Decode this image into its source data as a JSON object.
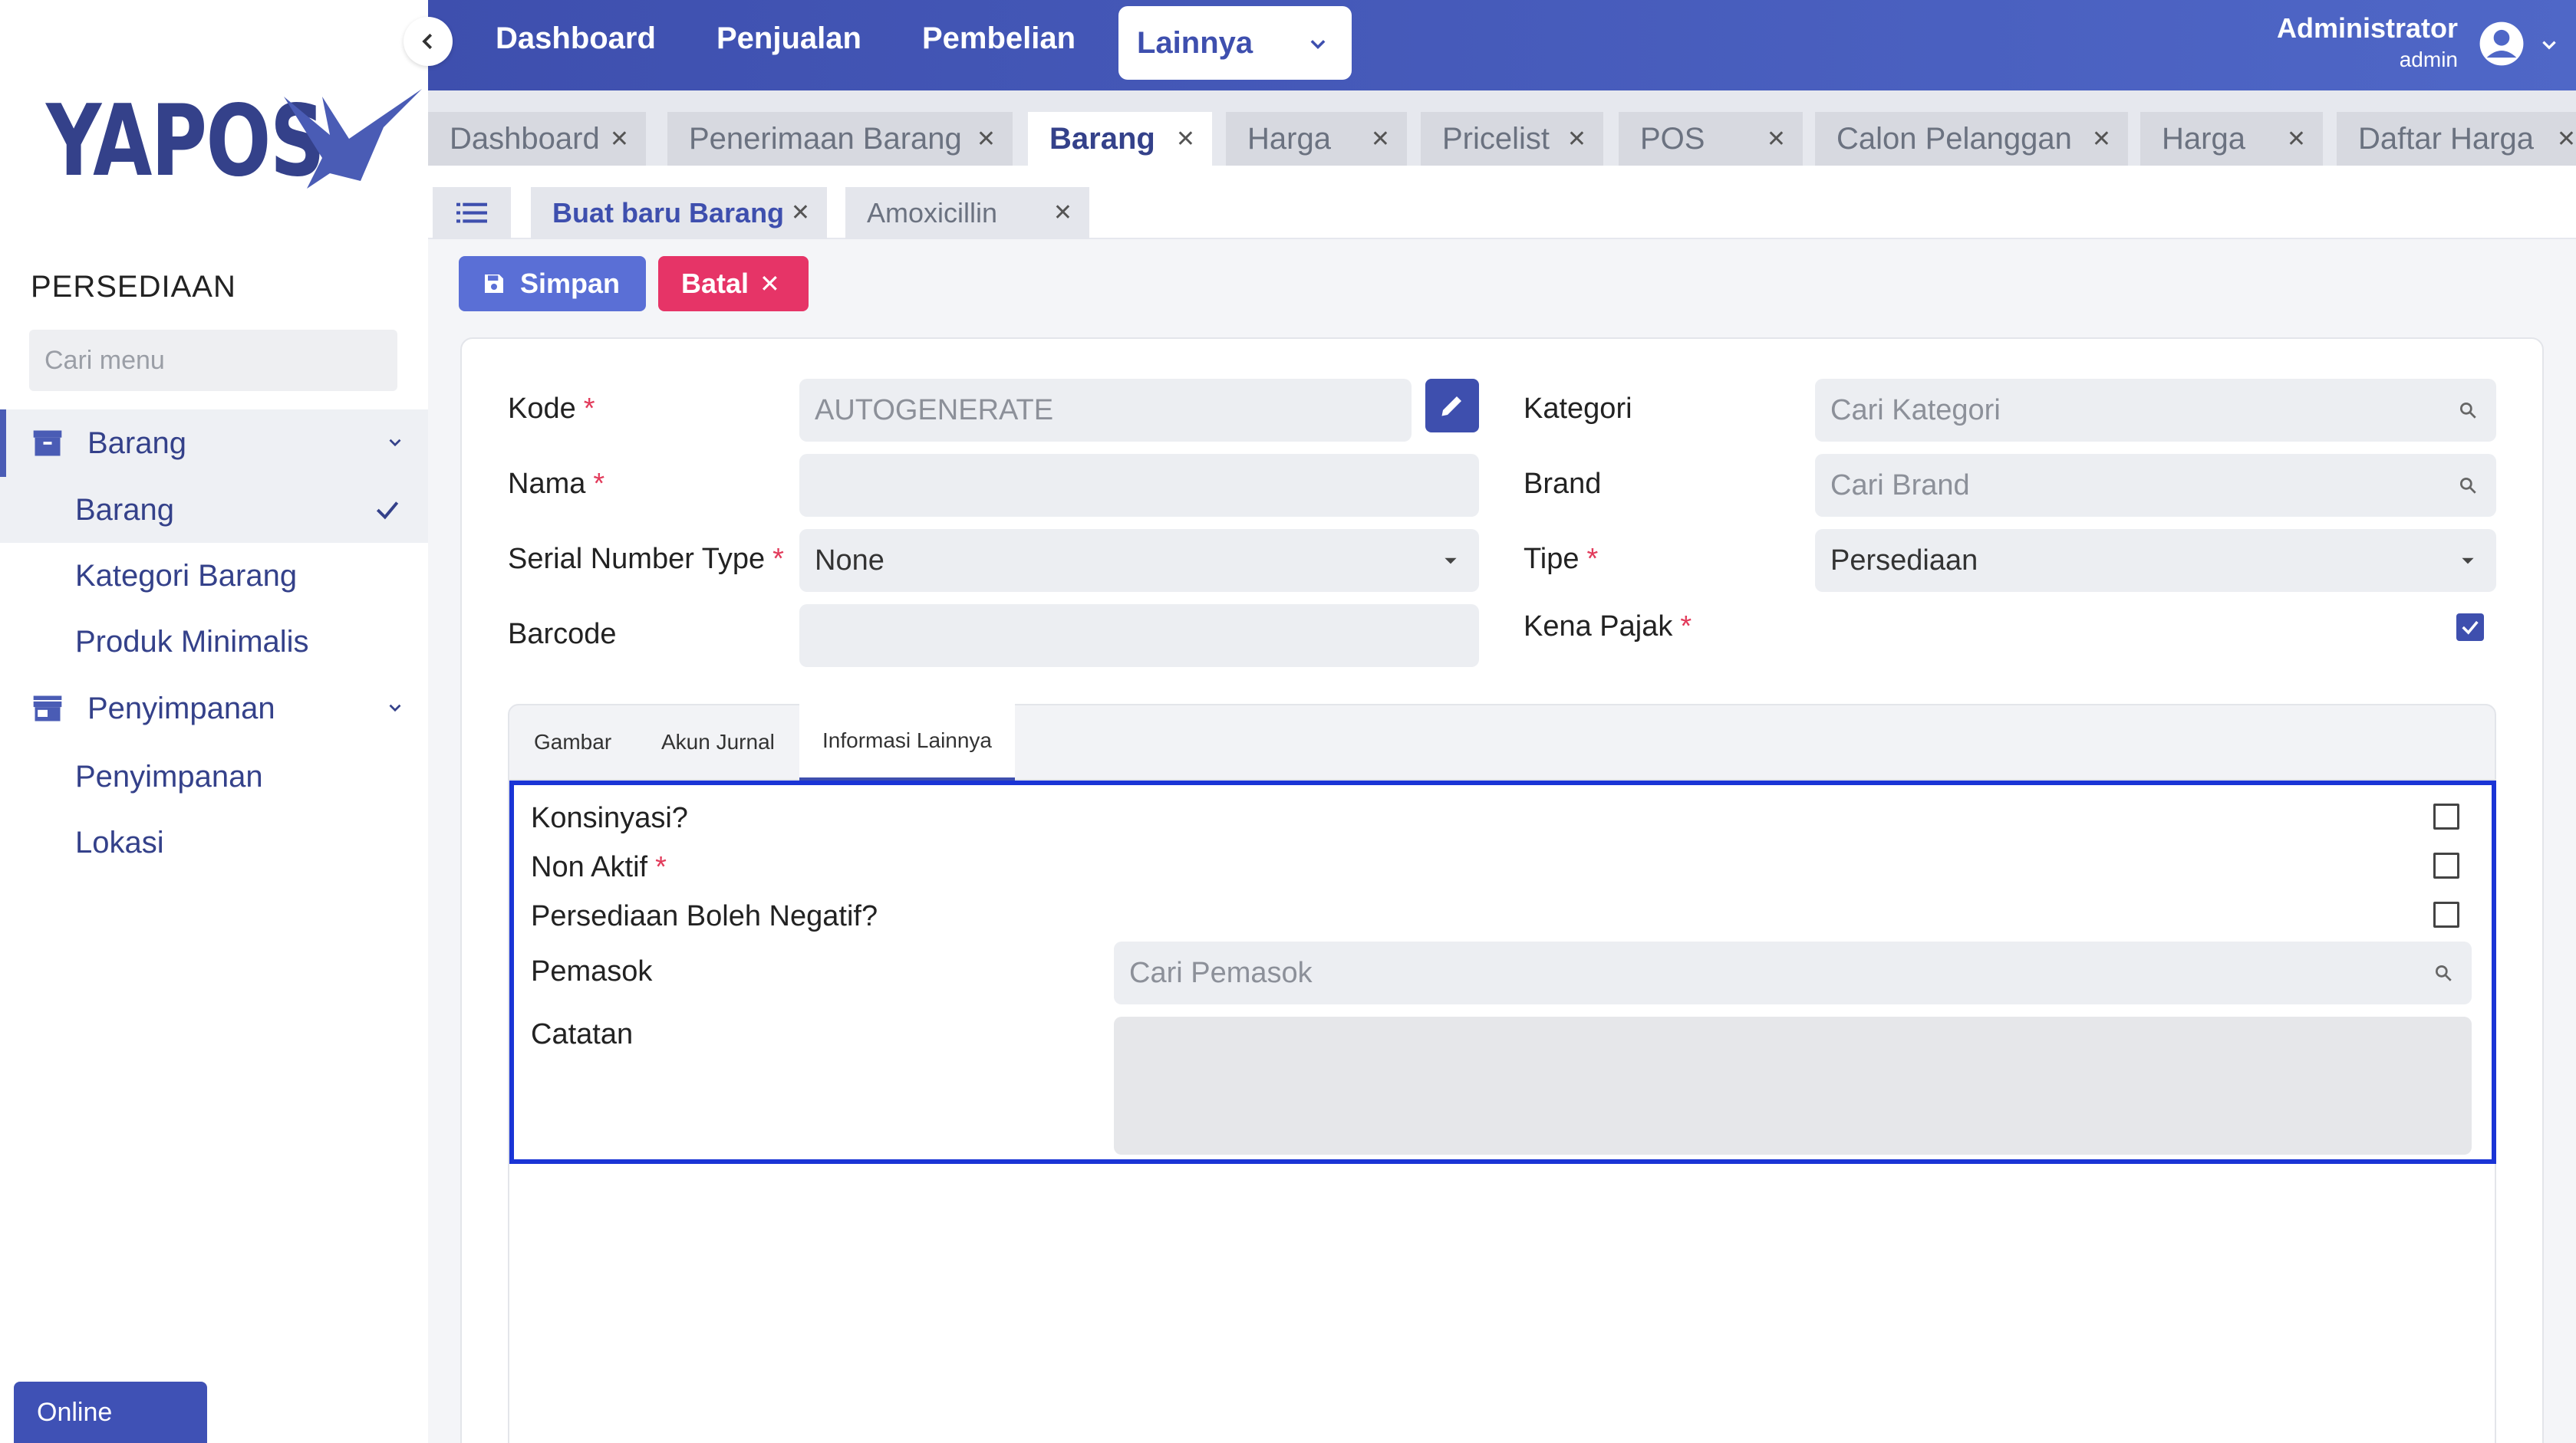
{
  "app": {
    "logo": "YAPOS",
    "brand_color": "#3e4fae"
  },
  "sidebar": {
    "section_title": "PERSEDIAAN",
    "search_placeholder": "Cari menu",
    "groups": [
      {
        "label": "Barang",
        "icon": "archive-icon",
        "items": [
          {
            "label": "Barang",
            "active": true
          },
          {
            "label": "Kategori Barang"
          },
          {
            "label": "Produk Minimalis"
          }
        ]
      },
      {
        "label": "Penyimpanan",
        "icon": "store-icon",
        "items": [
          {
            "label": "Penyimpanan"
          },
          {
            "label": "Lokasi"
          }
        ]
      }
    ],
    "status": "Online"
  },
  "topnav": {
    "items": [
      "Dashboard",
      "Penjualan",
      "Pembelian",
      "Lainnya"
    ],
    "user_name": "Administrator",
    "user_role": "admin"
  },
  "main_tabs": [
    "Dashboard",
    "Penerimaan Barang",
    "Barang",
    "Harga",
    "Pricelist",
    "POS",
    "Calon Pelanggan",
    "Harga",
    "Daftar Harga"
  ],
  "sub_tabs": [
    "Buat baru Barang",
    "Amoxicillin"
  ],
  "actions": {
    "save": "Simpan",
    "cancel": "Batal"
  },
  "form": {
    "kode": {
      "label": "Kode",
      "value": "AUTOGENERATE"
    },
    "nama": {
      "label": "Nama",
      "value": ""
    },
    "serial": {
      "label": "Serial Number Type",
      "value": "None"
    },
    "barcode": {
      "label": "Barcode",
      "value": ""
    },
    "kategori": {
      "label": "Kategori",
      "placeholder": "Cari Kategori"
    },
    "brand": {
      "label": "Brand",
      "placeholder": "Cari Brand"
    },
    "tipe": {
      "label": "Tipe",
      "value": "Persediaan"
    },
    "kena_pajak": {
      "label": "Kena Pajak",
      "checked": true
    }
  },
  "inner_tabs": [
    "Gambar",
    "Akun Jurnal",
    "Informasi Lainnya"
  ],
  "info": {
    "konsinyasi": {
      "label": "Konsinyasi?",
      "checked": false
    },
    "non_aktif": {
      "label": "Non Aktif",
      "checked": false
    },
    "negatif": {
      "label": "Persediaan Boleh Negatif?",
      "checked": false
    },
    "pemasok": {
      "label": "Pemasok",
      "placeholder": "Cari Pemasok"
    },
    "catatan": {
      "label": "Catatan",
      "value": ""
    }
  }
}
